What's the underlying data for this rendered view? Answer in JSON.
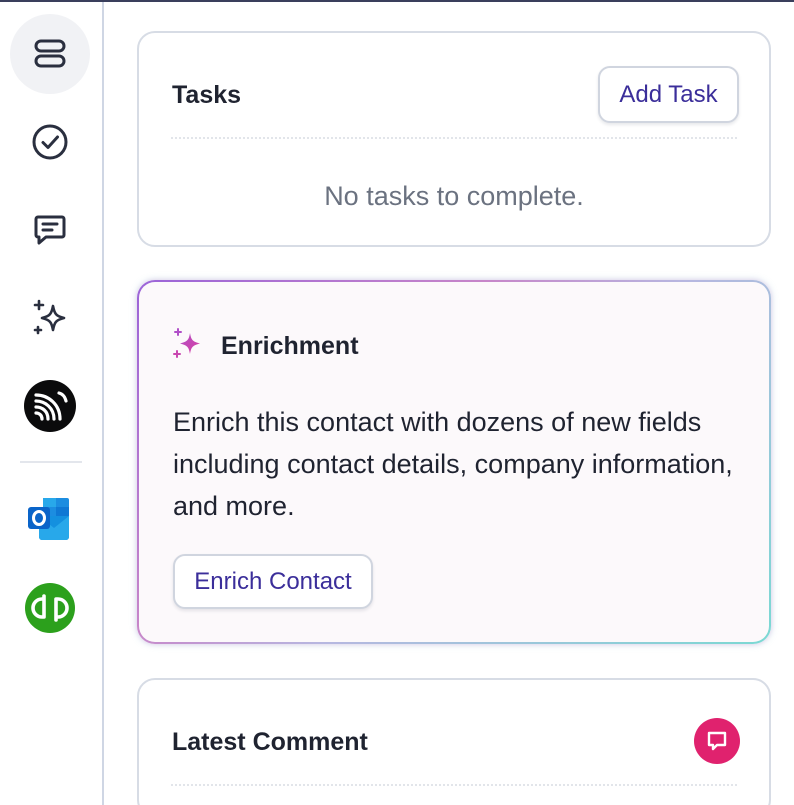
{
  "sidebar": {
    "items": [
      {
        "name": "list-view",
        "icon": "stack-icon",
        "active": true
      },
      {
        "name": "tasks",
        "icon": "check-circle-icon"
      },
      {
        "name": "comments",
        "icon": "message-icon"
      },
      {
        "name": "enrichment",
        "icon": "sparkles-icon"
      },
      {
        "name": "integration",
        "icon": "feed-icon"
      },
      {
        "name": "outlook",
        "icon": "outlook-icon"
      },
      {
        "name": "quickbooks",
        "icon": "quickbooks-icon"
      }
    ]
  },
  "tasks": {
    "title": "Tasks",
    "add_label": "Add Task",
    "empty_text": "No tasks to complete."
  },
  "enrichment": {
    "title": "Enrichment",
    "description": "Enrich this contact with dozens of new fields including contact details, company information, and more.",
    "button_label": "Enrich Contact"
  },
  "latest_comment": {
    "title": "Latest Comment"
  },
  "colors": {
    "accent": "#3b2e9a",
    "comment_badge": "#e0226e",
    "quickbooks": "#2ca01c",
    "outlook": "#0a64c9"
  }
}
